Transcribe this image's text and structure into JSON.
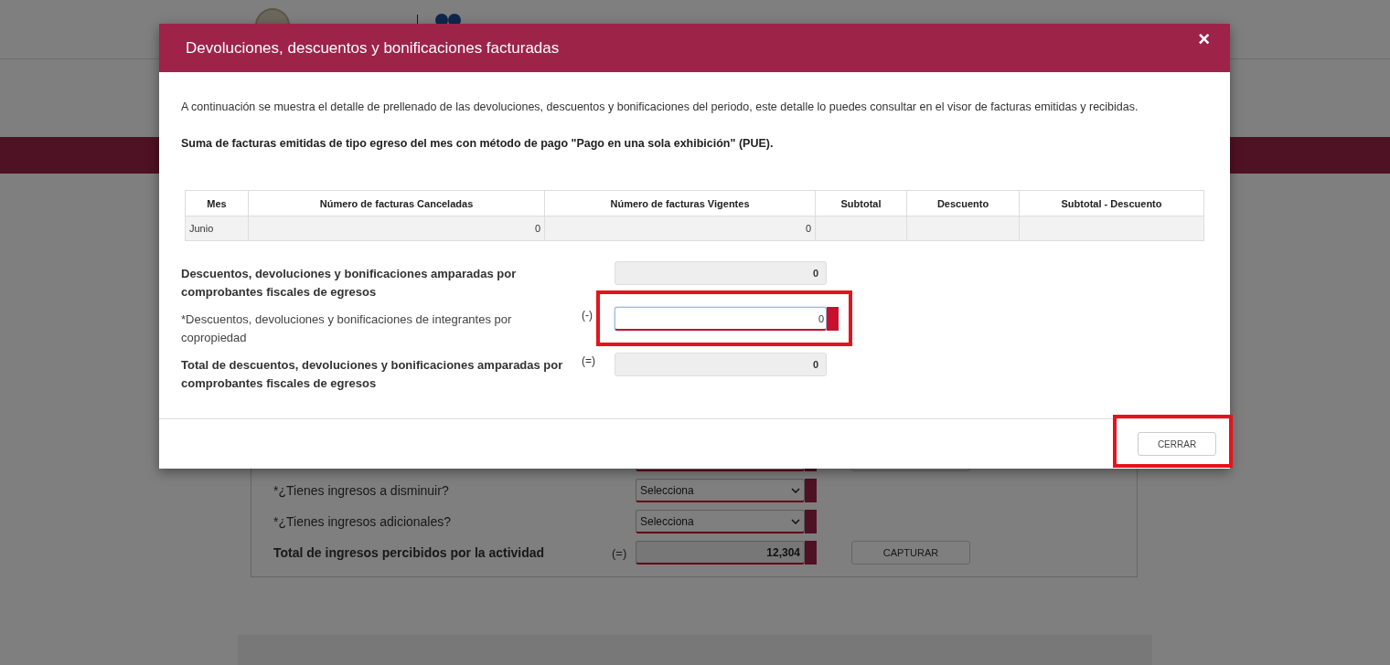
{
  "background": {
    "rows": [
      {
        "kind": "covered",
        "error": true
      },
      {
        "kind": "select",
        "label": "*¿Tienes ingresos a disminuir?",
        "bold": false,
        "value": "Selecciona",
        "error": true
      },
      {
        "kind": "select",
        "label": "*¿Tienes ingresos adicionales?",
        "bold": false,
        "value": "Selecciona",
        "error": true
      },
      {
        "kind": "total",
        "label": "Total de ingresos percibidos por la actividad",
        "bold": true,
        "sign": "(=)",
        "value": "12,304",
        "error": true,
        "button": "CAPTURAR"
      }
    ]
  },
  "modal": {
    "title": "Devoluciones, descuentos y bonificaciones facturadas",
    "close": "×",
    "intro": "A continuación se muestra el detalle de prellenado de las devoluciones, descuentos y bonificaciones del periodo, este detalle lo puedes consultar en el visor de facturas emitidas y recibidas.",
    "subtitle": "Suma de facturas emitidas de tipo egreso del mes con método de pago \"Pago en una sola exhibición\" (PUE).",
    "table": {
      "columns": [
        "Mes",
        "Número de facturas Canceladas",
        "Número de facturas Vigentes",
        "Subtotal",
        "Descuento",
        "Subtotal - Descuento"
      ],
      "rows": [
        [
          "Junio",
          "0",
          "0",
          "",
          "",
          ""
        ]
      ]
    },
    "fields": [
      {
        "label": "Descuentos, devoluciones y bonificaciones amparadas por comprobantes fiscales de egresos",
        "bold": true,
        "kind": "readonly",
        "value": "0",
        "error": false,
        "highlighted": false
      },
      {
        "label": "*Descuentos, devoluciones y bonificaciones de integrantes por copropiedad",
        "bold": false,
        "sign": "(-)",
        "kind": "input",
        "value": "0",
        "error": true,
        "highlighted": true
      },
      {
        "label": "Total de descuentos, devoluciones y bonificaciones amparadas por comprobantes fiscales de egresos",
        "bold": true,
        "sign": "(=)",
        "kind": "readonly",
        "value": "0",
        "error": false,
        "highlighted": false
      }
    ],
    "button": {
      "label": "CERRAR",
      "highlighted": true
    }
  }
}
